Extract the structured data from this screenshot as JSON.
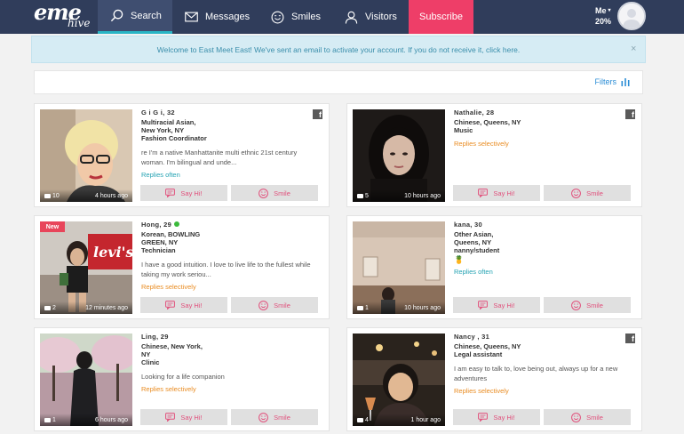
{
  "brand": {
    "logo_main": "eme",
    "logo_sub": "hive"
  },
  "nav": {
    "search": "Search",
    "messages": "Messages",
    "smiles": "Smiles",
    "visitors": "Visitors",
    "subscribe": "Subscribe"
  },
  "me": {
    "label": "Me",
    "completion": "20%"
  },
  "notice": {
    "text": "Welcome to East Meet East! We've sent an email to activate your account. If you do not receive it, click here.",
    "close": "×"
  },
  "filters": {
    "label": "Filters"
  },
  "buttons": {
    "say_hi": "Say Hi!",
    "smile": "Smile"
  },
  "profiles": [
    {
      "name": "G i G i, 32",
      "line1": "Multiracial Asian,",
      "line2": "New York, NY",
      "line3": "Fashion Coordinator",
      "bio": "re I'm a native Manhattanite multi ethnic 21st century woman. I'm bilingual and unde...",
      "reply": "Replies often",
      "photos": "10",
      "last_seen": "4 hours ago",
      "facebook": "f"
    },
    {
      "name": "Nathalie, 28",
      "line1": "Chinese, Queens, NY",
      "line2": "Music",
      "reply": "Replies selectively",
      "photos": "5",
      "last_seen": "10 hours ago",
      "facebook": "f"
    },
    {
      "name": "Hong, 29",
      "badge": "New",
      "line1": "Korean, BOWLING",
      "line2": "GREEN, NY",
      "line3": "Technician",
      "bio": "I have a good intuition. I love to live life to the fullest while taking my work seriou...",
      "reply": "Replies selectively",
      "photos": "2",
      "last_seen": "12 minutes ago"
    },
    {
      "name": "kana, 30",
      "line1": "Other Asian,",
      "line2": "Queens, NY",
      "line3": "nanny/student",
      "emoji": "🍍",
      "reply": "Replies often",
      "photos": "1",
      "last_seen": "10 hours ago"
    },
    {
      "name": "Ling, 29",
      "line1": "Chinese, New York,",
      "line2": "NY",
      "line3": "Clinic",
      "bio": "Looking for a life companion",
      "reply": "Replies selectively",
      "photos": "1",
      "last_seen": "6 hours ago"
    },
    {
      "name": "Nancy , 31",
      "line1": "Chinese, Queens, NY",
      "line2": "Legal assistant",
      "bio": "I am easy to talk to, love being out, always up for a new adventures",
      "reply": "Replies selectively",
      "photos": "4",
      "last_seen": "1 hour ago",
      "facebook": "f"
    }
  ]
}
